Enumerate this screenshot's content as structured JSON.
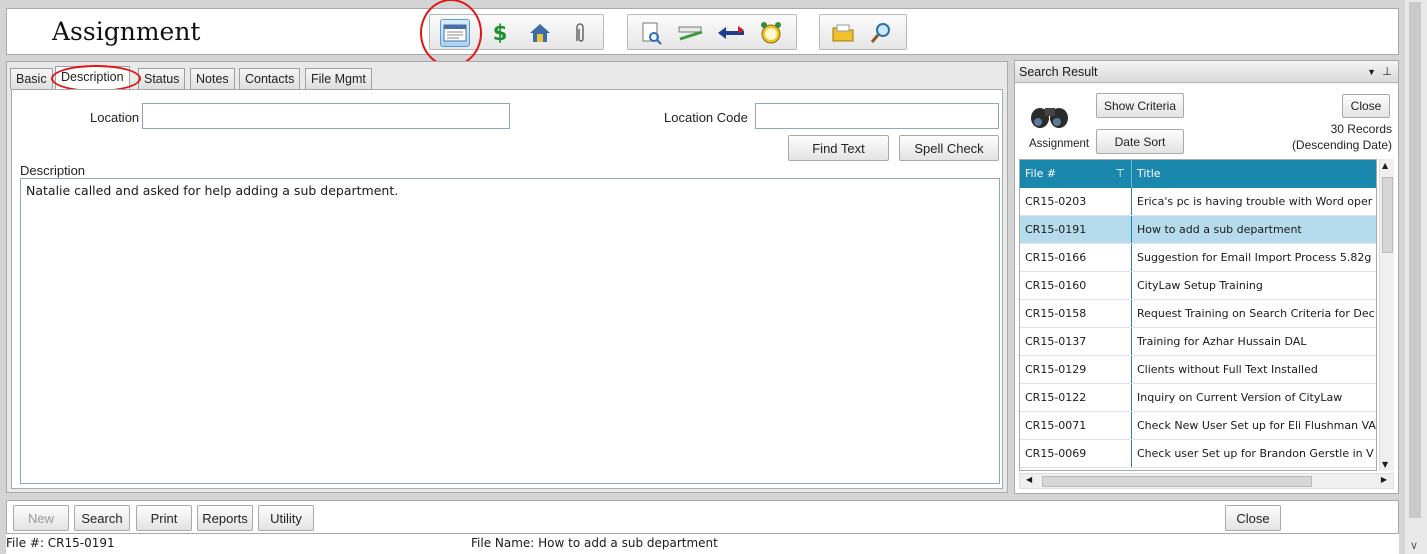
{
  "header": {
    "title": "Assignment",
    "toolbar_icons": [
      "form-icon",
      "dollar-icon",
      "house-icon",
      "paperclip-icon",
      "preview-icon",
      "ruler-pen-icon",
      "transfer-arrows-icon",
      "alarm-clock-icon",
      "folder-icon",
      "search-magnifier-icon"
    ]
  },
  "tabs": [
    {
      "label": "Basic"
    },
    {
      "label": "Description",
      "active": true
    },
    {
      "label": "Status"
    },
    {
      "label": "Notes"
    },
    {
      "label": "Contacts"
    },
    {
      "label": "File Mgmt"
    }
  ],
  "form": {
    "location_label": "Location",
    "location_value": "",
    "location_code_label": "Location Code",
    "location_code_value": "",
    "find_text_label": "Find Text",
    "spell_check_label": "Spell Check",
    "description_label": "Description",
    "description_value": "Natalie called and asked for help adding a sub department."
  },
  "search_panel": {
    "title": "Search Result",
    "show_criteria_label": "Show Criteria",
    "date_sort_label": "Date Sort",
    "close_label": "Close",
    "icon_caption": "Assignment",
    "record_count": "30 Records",
    "sort_note": "(Descending Date)",
    "columns": [
      "File #",
      "Title"
    ],
    "rows": [
      {
        "file": "CR15-0203",
        "title": "Erica's pc is having trouble with Word oper"
      },
      {
        "file": "CR15-0191",
        "title": "How to add a sub department",
        "selected": true
      },
      {
        "file": "CR15-0166",
        "title": "Suggestion for Email Import Process 5.82g"
      },
      {
        "file": "CR15-0160",
        "title": "CityLaw Setup Training"
      },
      {
        "file": "CR15-0158",
        "title": "Request Training on Search Criteria for Dec"
      },
      {
        "file": "CR15-0137",
        "title": "Training for Azhar Hussain DAL"
      },
      {
        "file": "CR15-0129",
        "title": "Clients without Full Text Installed"
      },
      {
        "file": "CR15-0122",
        "title": "Inquiry on Current Version of CityLaw"
      },
      {
        "file": "CR15-0071",
        "title": "Check New User Set up for Eli Flushman VA"
      },
      {
        "file": "CR15-0069",
        "title": "Check user Set up for Brandon Gerstle in V"
      }
    ]
  },
  "bottom_bar": {
    "new_label": "New",
    "search_label": "Search",
    "print_label": "Print",
    "reports_label": "Reports",
    "utility_label": "Utility",
    "close_label": "Close"
  },
  "status": {
    "file_no": "File #: CR15-0191",
    "file_name": "File Name: How to add a sub department"
  },
  "colors": {
    "grid_header": "#1a87ad",
    "selected_row": "#b5dbec",
    "annotation": "#e01515"
  }
}
